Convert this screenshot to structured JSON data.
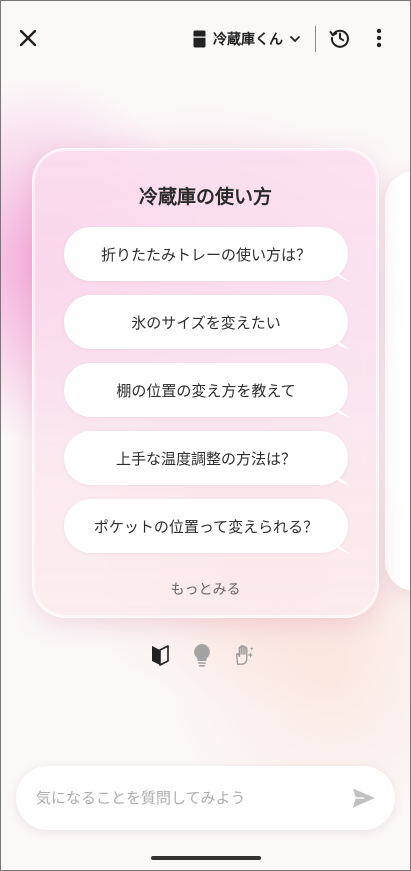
{
  "header": {
    "device_name": "冷蔵庫くん"
  },
  "card": {
    "title": "冷蔵庫の使い方",
    "suggestions": [
      "折りたたみトレーの使い方は？",
      "氷のサイズを変えたい",
      "棚の位置の変え方を教えて",
      "上手な温度調整の方法は？",
      "ポケットの位置って変えられる？"
    ],
    "more_label": "もっとみる"
  },
  "categories": [
    {
      "icon": "beginner-mark-icon",
      "selected": true
    },
    {
      "icon": "lightbulb-icon",
      "selected": false
    },
    {
      "icon": "sparkle-hand-icon",
      "selected": false
    }
  ],
  "input": {
    "placeholder": "気になることを質問してみよう",
    "value": ""
  },
  "colors": {
    "accent_pink": "#f07ac8",
    "icon_dark": "#222222",
    "icon_muted": "#9a9a9a"
  }
}
